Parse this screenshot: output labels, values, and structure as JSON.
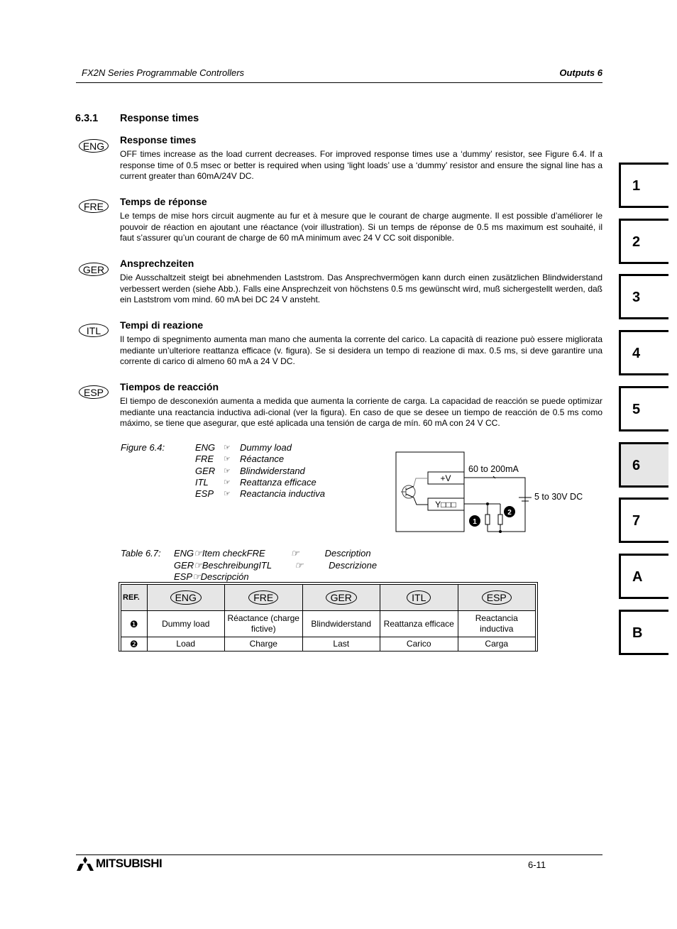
{
  "header": {
    "doc_title": "FX2N Series Programmable Controllers",
    "chapter": "Outputs 6"
  },
  "section": {
    "number": "6.3.1",
    "title": "Response times"
  },
  "languages": [
    {
      "code": "ENG",
      "heading": "Response times",
      "text": "OFF times increase as the load current decreases. For improved response times use a ‘dummy’ resistor, see Figure 6.4. If a response time of 0.5 msec or better is required when using ‘light loads’ use a ‘dummy’ resistor and ensure the signal line has a current greater than 60mA/24V DC."
    },
    {
      "code": "FRE",
      "heading": "Temps de réponse",
      "text": "Le temps de mise hors circuit augmente au fur et à mesure que le courant de charge augmente. Il est possible d’améliorer le pouvoir de réaction en ajoutant une réactance (voir illustration). Si un temps de réponse de 0.5 ms maximum est souhaité, il faut s’assurer qu’un courant de charge de 60 mA minimum avec 24 V CC soit disponible."
    },
    {
      "code": "GER",
      "heading": "Ansprechzeiten",
      "text": "Die Ausschaltzeit steigt bei abnehmenden Laststrom. Das Ansprechvermögen kann durch einen zusätzlichen Blindwiderstand verbessert werden (siehe Abb.). Falls eine Ansprechzeit von höchstens 0.5 ms gewünscht wird, muß sichergestellt werden, daß ein Laststrom vom mind. 60 mA bei DC 24 V ansteht."
    },
    {
      "code": "ITL",
      "heading": "Tempi di reazione",
      "text": "Il tempo di spegnimento aumenta man mano che aumenta la corrente del carico. La capacità di reazione può essere migliorata mediante un’ulteriore reattanza efficace (v. figura). Se si desidera un tempo di reazione di max. 0.5 ms, si deve garantire una corrente di carico di almeno 60 mA a 24 V DC."
    },
    {
      "code": "ESP",
      "heading": "Tiempos de reacción",
      "text": "El tiempo de desconexión aumenta a medida que aumenta la corriente de carga. La capacidad de reacción se puede optimizar mediante una reactancia inductiva adi-cional (ver la figura). En caso de que se desee un tiempo de reacción de 0.5 ms como máximo, se tiene que asegurar, que esté aplicada una tensión de carga de mín. 60 mA con 24 V CC."
    }
  ],
  "figure": {
    "caption": "Figure 6.4:",
    "pointer_glyph": "☞",
    "entries": [
      {
        "code": "ENG",
        "label": "Dummy load"
      },
      {
        "code": "FRE",
        "label": "Réactance"
      },
      {
        "code": "GER",
        "label": "Blindwiderstand"
      },
      {
        "code": "ITL",
        "label": "Reattanza efficace"
      },
      {
        "code": "ESP",
        "label": "Reactancia inductiva"
      }
    ],
    "diagram": {
      "plus_v": "+V",
      "output_terminal": "Y□□□",
      "current_label": "60 to 200mA",
      "voltage_label": "5 to 30V DC",
      "marker_1": "1",
      "marker_2": "2"
    }
  },
  "table": {
    "caption": "Table 6.7:",
    "caption_lines": [
      "ENG☞Item checkFRE          ☞          Description",
      "GER☞BeschreibungITL         ☞          Descrizione",
      "ESP☞Descripción"
    ],
    "headers": [
      "REF.",
      "ENG",
      "FRE",
      "GER",
      "ITL",
      "ESP"
    ],
    "rows": [
      {
        "ref": "❶",
        "cells": [
          "Dummy load",
          "Réactance (charge fictive)",
          "Blindwiderstand",
          "Reattanza efficace",
          "Reactancia inductiva"
        ]
      },
      {
        "ref": "❷",
        "cells": [
          "Load",
          "Charge",
          "Last",
          "Carico",
          "Carga"
        ]
      }
    ]
  },
  "side_tabs": [
    {
      "label": "1",
      "active": false
    },
    {
      "label": "2",
      "active": false
    },
    {
      "label": "3",
      "active": false
    },
    {
      "label": "4",
      "active": false
    },
    {
      "label": "5",
      "active": false
    },
    {
      "label": "6",
      "active": true
    },
    {
      "label": "7",
      "active": false
    },
    {
      "label": "A",
      "active": false
    },
    {
      "label": "B",
      "active": false
    }
  ],
  "footer": {
    "brand": "MITSUBISHI",
    "page_number": "6-11"
  }
}
